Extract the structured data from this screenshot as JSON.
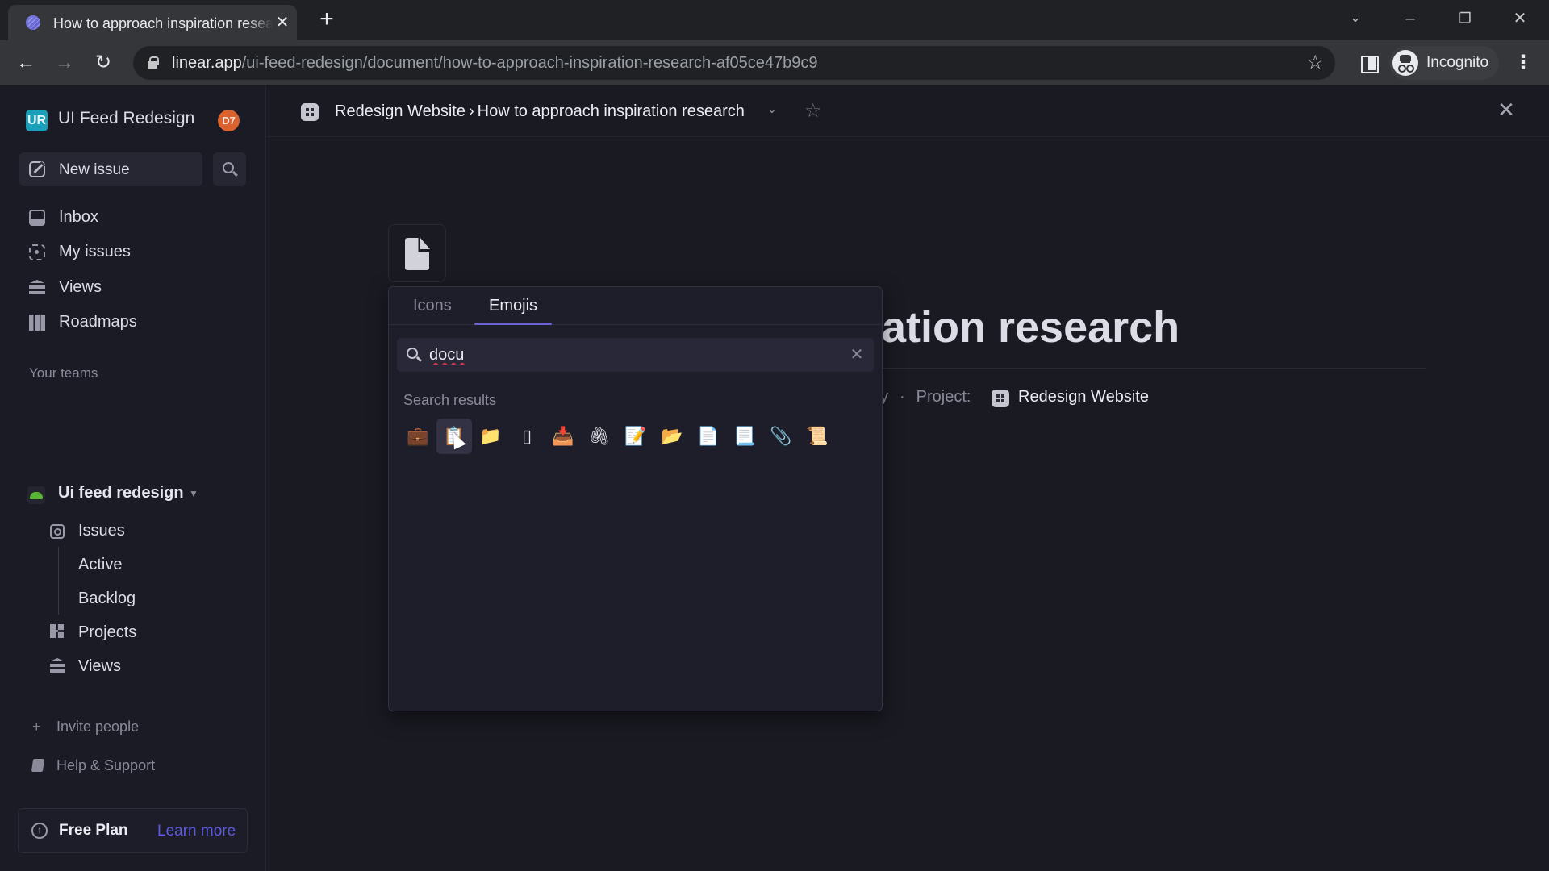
{
  "browser": {
    "tab_title": "How to approach inspiration research",
    "url_host": "linear.app",
    "url_path": "/ui-feed-redesign/document/how-to-approach-inspiration-research-af05ce47b9c9",
    "profile_label": "Incognito"
  },
  "sidebar": {
    "workspace_initials": "UR",
    "workspace_name": "UI Feed Redesign",
    "user_initials": "D7",
    "new_issue_label": "New issue",
    "nav": [
      {
        "label": "Inbox",
        "icon": "inbox-icon"
      },
      {
        "label": "My issues",
        "icon": "my-issues-icon"
      },
      {
        "label": "Views",
        "icon": "views-icon"
      },
      {
        "label": "Roadmaps",
        "icon": "roadmap-icon"
      }
    ],
    "teams_label": "Your teams",
    "team": {
      "name": "Ui feed redesign",
      "items": [
        {
          "label": "Issues"
        },
        {
          "label": "Active"
        },
        {
          "label": "Backlog"
        },
        {
          "label": "Projects"
        },
        {
          "label": "Views"
        }
      ]
    },
    "invite_label": "Invite people",
    "help_label": "Help & Support",
    "plan_label": "Free Plan",
    "learn_more_label": "Learn more"
  },
  "header": {
    "project": "Redesign Website",
    "separator": "›",
    "document": "How to approach inspiration research"
  },
  "document": {
    "title_visible": "ation research",
    "meta_prefix_visible": "y",
    "meta_separator": "·",
    "project_label": "Project:",
    "project_name": "Redesign Website"
  },
  "icon_picker": {
    "tabs": [
      {
        "label": "Icons",
        "active": false
      },
      {
        "label": "Emojis",
        "active": true
      }
    ],
    "search_value": "docu",
    "results_label": "Search results",
    "results": [
      {
        "name": "briefcase",
        "glyph": "💼"
      },
      {
        "name": "clipboard",
        "glyph": "📋",
        "hovered": true
      },
      {
        "name": "file-folder",
        "glyph": "📁"
      },
      {
        "name": "mobile-phone",
        "glyph": "▯"
      },
      {
        "name": "inbox-tray",
        "glyph": "📥"
      },
      {
        "name": "linked-paperclips",
        "glyph": "🖇"
      },
      {
        "name": "memo",
        "glyph": "📝"
      },
      {
        "name": "open-file-folder",
        "glyph": "📂"
      },
      {
        "name": "page-facing-up",
        "glyph": "📄"
      },
      {
        "name": "page-with-curl",
        "glyph": "📃"
      },
      {
        "name": "paperclip",
        "glyph": "📎"
      },
      {
        "name": "scroll",
        "glyph": "📜"
      }
    ]
  },
  "colors": {
    "accent": "#6d63d8",
    "link": "#5f5be0",
    "workspace_logo": "#1aa0b8",
    "avatar": "#d9622f",
    "team_icon": "#59b534"
  }
}
